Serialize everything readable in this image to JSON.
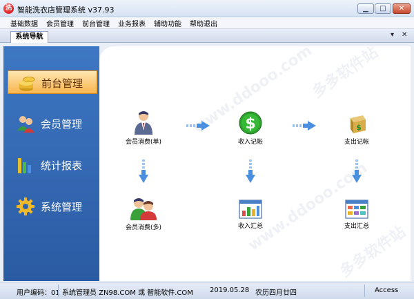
{
  "window": {
    "title": "智能洗衣店管理系统 v37.93",
    "app_icon": "洗",
    "controls": {
      "minimize": "▁",
      "maximize": "□",
      "close": "✕"
    }
  },
  "menu": [
    "基础数据",
    "会员管理",
    "前台管理",
    "业务报表",
    "辅助功能",
    "帮助退出"
  ],
  "tabs": {
    "active": "系统导航",
    "dropdown": "▾",
    "close": "✕"
  },
  "sidebar": {
    "items": [
      {
        "label": "前台管理",
        "icon": "coins-icon",
        "active": true
      },
      {
        "label": "会员管理",
        "icon": "users-icon",
        "active": false
      },
      {
        "label": "统计报表",
        "icon": "bar-chart-icon",
        "active": false
      },
      {
        "label": "系统管理",
        "icon": "gear-icon",
        "active": false
      }
    ]
  },
  "flow": {
    "nodes": [
      {
        "id": "member-consume-single",
        "label": "会员消费(单)",
        "icon": "single-member-icon"
      },
      {
        "id": "income-record",
        "label": "收入记帐",
        "icon": "dollar-icon"
      },
      {
        "id": "expense-record",
        "label": "支出记帐",
        "icon": "money-bag-icon"
      },
      {
        "id": "member-consume-multi",
        "label": "会员消费(多)",
        "icon": "multi-member-icon"
      },
      {
        "id": "income-summary",
        "label": "收入汇总",
        "icon": "chart-window-icon"
      },
      {
        "id": "expense-summary",
        "label": "支出汇总",
        "icon": "grid-window-icon"
      }
    ]
  },
  "watermarks": [
    "多多软件站",
    "www.ddooo.com",
    "多多软件站",
    "www.ddooo.com"
  ],
  "statusbar": {
    "user_code": "用户编码：01",
    "operator": "系统管理员  ZN98.COM 或 智能软件.COM",
    "date": "2019.05.28",
    "lunar": "农历四月廿四",
    "db": "Access"
  },
  "colors": {
    "nav_bg": "#2f63ad",
    "nav_active": "#f7b54e",
    "arrow_blue": "#4a8fe0"
  }
}
